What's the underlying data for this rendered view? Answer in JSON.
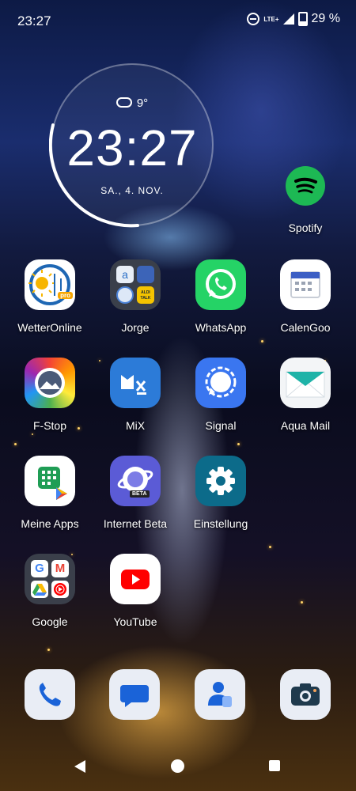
{
  "status": {
    "time": "23:27",
    "network": "LTE+",
    "battery": "29 %"
  },
  "clock_widget": {
    "temperature": "9°",
    "time": "23:27",
    "date": "SA.,  4.  NOV."
  },
  "apps": [
    {
      "label": "Spotify"
    },
    {
      "label": "WetterOnline"
    },
    {
      "label": "Jorge"
    },
    {
      "label": "WhatsApp"
    },
    {
      "label": "CalenGoo"
    },
    {
      "label": "F-Stop"
    },
    {
      "label": "MiX"
    },
    {
      "label": "Signal"
    },
    {
      "label": "Aqua Mail"
    },
    {
      "label": "Meine Apps"
    },
    {
      "label": "Internet Beta"
    },
    {
      "label": "Einstellung"
    },
    {
      "label": "Google"
    },
    {
      "label": "YouTube"
    }
  ],
  "icon_text": {
    "pro": "pro",
    "aldi": "ALDI TALK",
    "beta": "BETA"
  },
  "dock": [
    "phone-icon",
    "messages-icon",
    "contacts-icon",
    "camera-icon"
  ],
  "colors": {
    "whatsapp": "#25d366",
    "spotify": "#1db954",
    "signal": "#3a76f0",
    "youtube": "#ff0000"
  }
}
